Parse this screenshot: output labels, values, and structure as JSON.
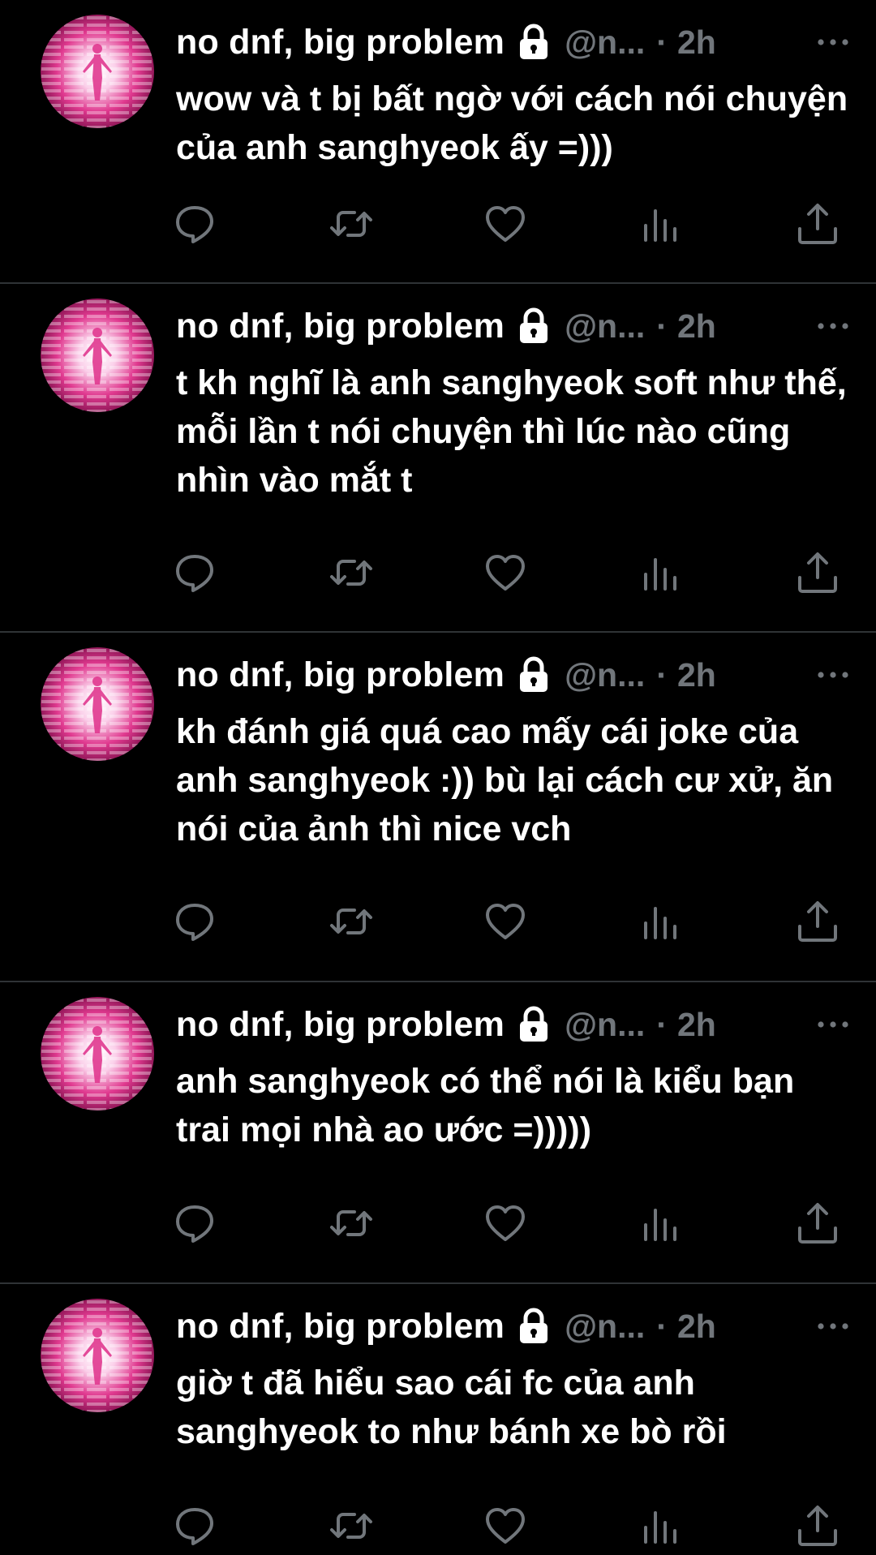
{
  "colors": {
    "background": "#000000",
    "primary_text": "#ffffff",
    "secondary_text": "#71767b",
    "icon": "#71767b",
    "divider": "#2f3336",
    "avatar_accent": "#e0398f"
  },
  "icons": {
    "lock": "lock-icon",
    "more": "more-horizontal-icon",
    "reply": "reply-icon",
    "retweet": "retweet-icon",
    "like": "like-icon",
    "views": "views-icon",
    "share": "share-icon"
  },
  "tweets": [
    {
      "display_name": "no dnf, big problem",
      "handle": "@n...",
      "separator": "·",
      "time": "2h",
      "text": "wow và t bị bất ngờ với cách nói chuyện của anh sanghyeok ấy =)))"
    },
    {
      "display_name": "no dnf, big problem",
      "handle": "@n...",
      "separator": "·",
      "time": "2h",
      "text": "t kh nghĩ là anh sanghyeok soft như thế, mỗi lần t nói chuyện thì lúc nào cũng nhìn vào mắt t"
    },
    {
      "display_name": "no dnf, big problem",
      "handle": "@n...",
      "separator": "·",
      "time": "2h",
      "text": "kh đánh giá quá cao mấy cái joke của anh sanghyeok :)) bù lại cách cư xử, ăn nói của ảnh thì nice vch"
    },
    {
      "display_name": "no dnf, big problem",
      "handle": "@n...",
      "separator": "·",
      "time": "2h",
      "text": "anh sanghyeok có thể nói là kiểu bạn trai mọi nhà ao ước =)))))"
    },
    {
      "display_name": "no dnf, big problem",
      "handle": "@n...",
      "separator": "·",
      "time": "2h",
      "text": "giờ t đã hiểu sao cái fc của anh sanghyeok to như bánh xe bò rồi"
    }
  ]
}
